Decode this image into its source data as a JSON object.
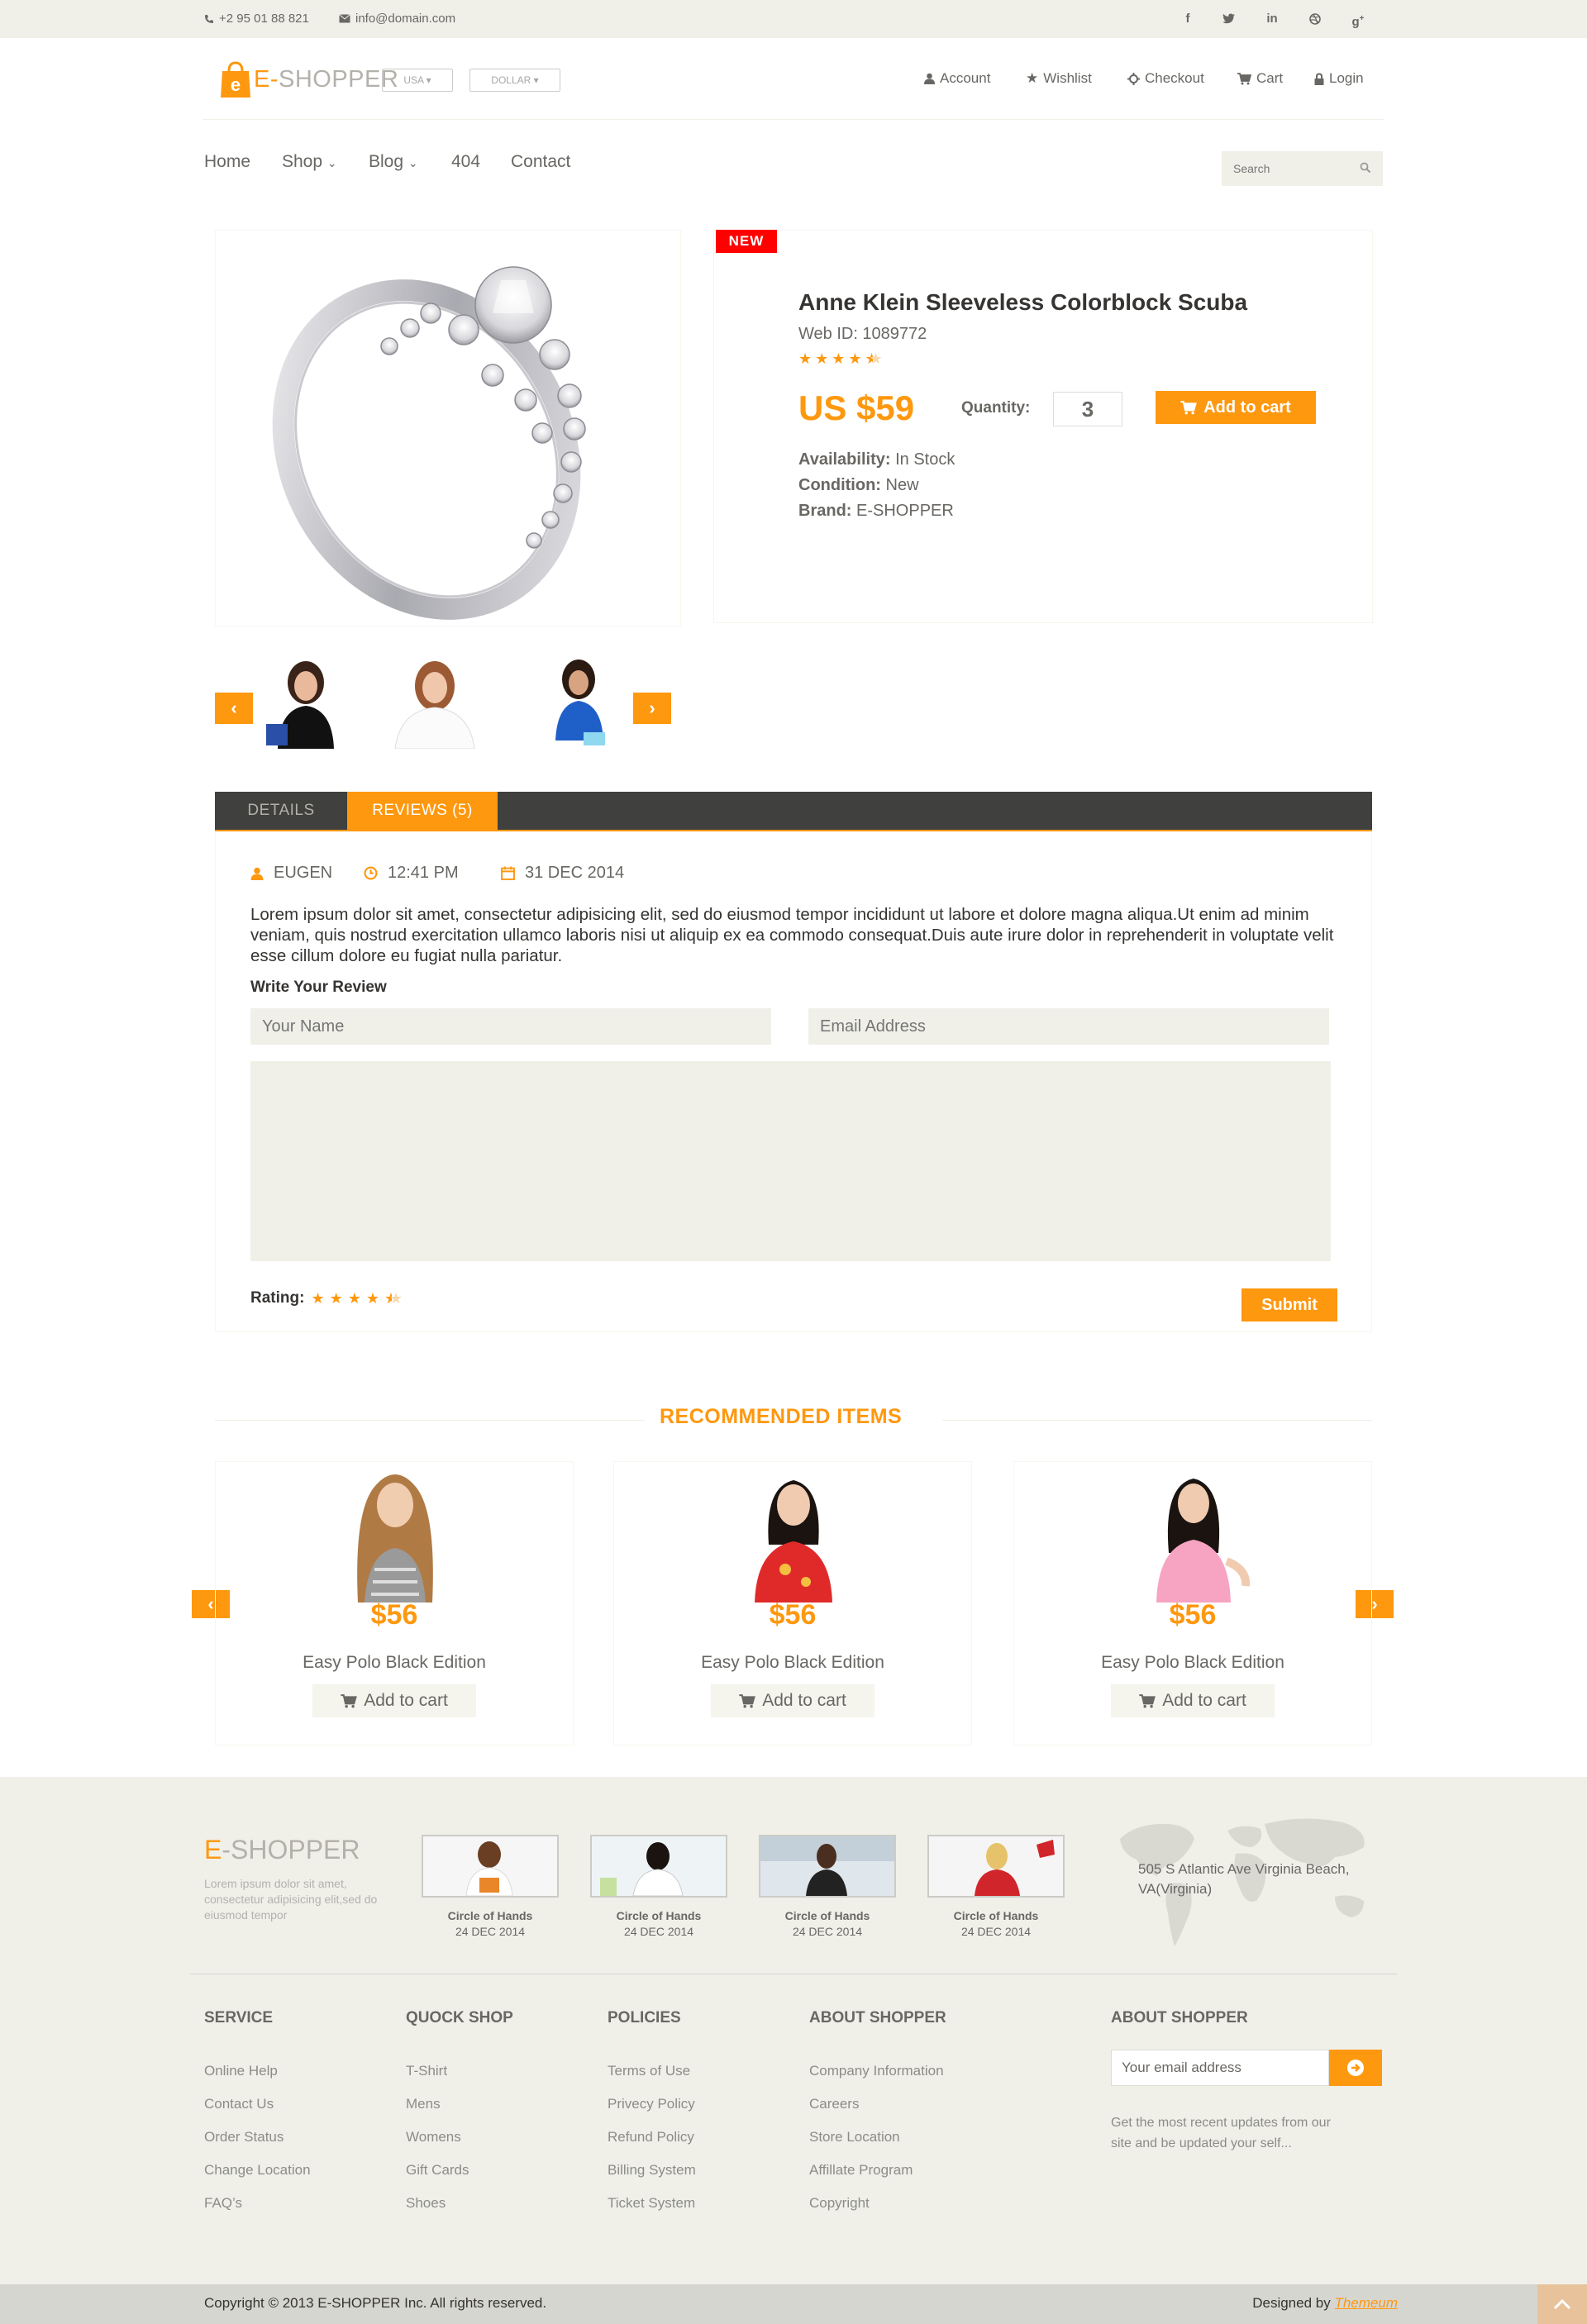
{
  "topbar": {
    "phone": "+2 95 01 88 821",
    "email": "info@domain.com",
    "social": [
      "facebook-icon",
      "twitter-icon",
      "linkedin-icon",
      "dribbble-icon",
      "google-plus-icon"
    ]
  },
  "header": {
    "logo_text": "SHOPPER",
    "logo_letter": "E-",
    "country": "USA",
    "currency": "DOLLAR",
    "usermenu": [
      {
        "label": "Account",
        "icon": "user-icon"
      },
      {
        "label": "Wishlist",
        "icon": "star-icon"
      },
      {
        "label": "Checkout",
        "icon": "crosshairs-icon"
      },
      {
        "label": "Cart",
        "icon": "cart-icon"
      },
      {
        "label": "Login",
        "icon": "lock-icon"
      }
    ]
  },
  "nav": {
    "items": [
      "Home",
      "Shop",
      "Blog",
      "404",
      "Contact"
    ],
    "search_placeholder": "Search"
  },
  "product": {
    "badge": "NEW",
    "title": "Anne Klein Sleeveless Colorblock Scuba",
    "web_id": "Web ID: 1089772",
    "rating": 4.5,
    "price": "US $59",
    "quantity_label": "Quantity:",
    "quantity": "3",
    "add_to_cart": "Add to cart",
    "availability_label": "Availability:",
    "availability": "In Stock",
    "condition_label": "Condition:",
    "condition": "New",
    "brand_label": "Brand:",
    "brand": "E-SHOPPER"
  },
  "tabs": {
    "details": "DETAILS",
    "reviews": "REVIEWS (5)"
  },
  "review": {
    "author": "EUGEN",
    "time": "12:41 PM",
    "date": "31 DEC 2014",
    "text": "Lorem ipsum dolor sit amet, consectetur adipisicing elit, sed do eiusmod tempor incididunt ut labore et dolore magna aliqua.Ut enim ad minim veniam, quis nostrud exercitation ullamco laboris nisi ut aliquip ex ea commodo consequat.Duis aute irure dolor in reprehenderit in voluptate velit esse cillum dolore eu fugiat nulla pariatur.",
    "write_label": "Write Your Review",
    "name_placeholder": "Your Name",
    "email_placeholder": "Email Address",
    "rating_label": "Rating:",
    "rating": 4.5,
    "submit": "Submit"
  },
  "recommended": {
    "title": "RECOMMENDED ITEMS",
    "items": [
      {
        "price": "$56",
        "name": "Easy Polo Black Edition",
        "button": "Add to cart"
      },
      {
        "price": "$56",
        "name": "Easy Polo Black Edition",
        "button": "Add to cart"
      },
      {
        "price": "$56",
        "name": "Easy Polo Black Edition",
        "button": "Add to cart"
      }
    ]
  },
  "footer": {
    "logo_e": "E",
    "logo_rest": "-SHOPPER",
    "description": "Lorem ipsum dolor sit amet, consectetur adipisicing elit,sed do eiusmod tempor",
    "videos": [
      {
        "title": "Circle of Hands",
        "date": "24 DEC 2014"
      },
      {
        "title": "Circle of Hands",
        "date": "24 DEC 2014"
      },
      {
        "title": "Circle of Hands",
        "date": "24 DEC 2014"
      },
      {
        "title": "Circle of Hands",
        "date": "24 DEC 2014"
      }
    ],
    "address": "505 S Atlantic Ave Virginia Beach, VA(Virginia)",
    "columns": [
      {
        "heading": "SERVICE",
        "links": [
          "Online Help",
          "Contact Us",
          "Order Status",
          "Change Location",
          "FAQ’s"
        ]
      },
      {
        "heading": "QUOCK SHOP",
        "links": [
          "T-Shirt",
          "Mens",
          "Womens",
          "Gift Cards",
          "Shoes"
        ]
      },
      {
        "heading": "POLICIES",
        "links": [
          "Terms of Use",
          "Privecy Policy",
          "Refund Policy",
          "Billing System",
          "Ticket System"
        ]
      },
      {
        "heading": "ABOUT SHOPPER",
        "links": [
          "Company Information",
          "Careers",
          "Store Location",
          "Affillate Program",
          "Copyright"
        ]
      }
    ],
    "newsletter_heading": "ABOUT SHOPPER",
    "email_placeholder": "Your email address",
    "newsletter_text": "Get the most recent updates from our site and be updated your self...",
    "copyright": "Copyright © 2013 E-SHOPPER Inc. All rights reserved.",
    "designed_by": "Designed by",
    "designer": "Themeum"
  },
  "colors": {
    "accent": "#FE980F",
    "tabbar": "#40403E",
    "footer_bg": "#F0F0E9",
    "badge": "#FE0000"
  }
}
